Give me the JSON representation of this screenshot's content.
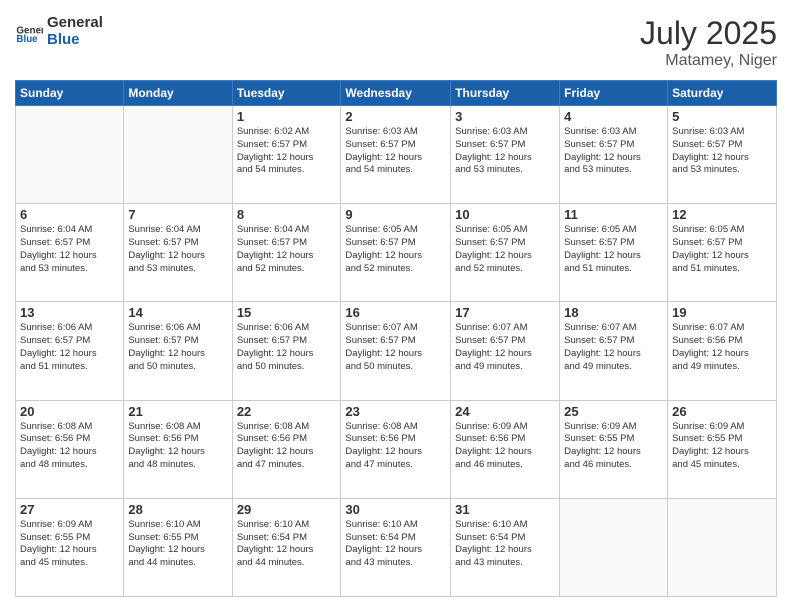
{
  "header": {
    "logo_general": "General",
    "logo_blue": "Blue",
    "month": "July 2025",
    "location": "Matamey, Niger"
  },
  "weekdays": [
    "Sunday",
    "Monday",
    "Tuesday",
    "Wednesday",
    "Thursday",
    "Friday",
    "Saturday"
  ],
  "weeks": [
    [
      {
        "day": "",
        "info": ""
      },
      {
        "day": "",
        "info": ""
      },
      {
        "day": "1",
        "info": "Sunrise: 6:02 AM\nSunset: 6:57 PM\nDaylight: 12 hours\nand 54 minutes."
      },
      {
        "day": "2",
        "info": "Sunrise: 6:03 AM\nSunset: 6:57 PM\nDaylight: 12 hours\nand 54 minutes."
      },
      {
        "day": "3",
        "info": "Sunrise: 6:03 AM\nSunset: 6:57 PM\nDaylight: 12 hours\nand 53 minutes."
      },
      {
        "day": "4",
        "info": "Sunrise: 6:03 AM\nSunset: 6:57 PM\nDaylight: 12 hours\nand 53 minutes."
      },
      {
        "day": "5",
        "info": "Sunrise: 6:03 AM\nSunset: 6:57 PM\nDaylight: 12 hours\nand 53 minutes."
      }
    ],
    [
      {
        "day": "6",
        "info": "Sunrise: 6:04 AM\nSunset: 6:57 PM\nDaylight: 12 hours\nand 53 minutes."
      },
      {
        "day": "7",
        "info": "Sunrise: 6:04 AM\nSunset: 6:57 PM\nDaylight: 12 hours\nand 53 minutes."
      },
      {
        "day": "8",
        "info": "Sunrise: 6:04 AM\nSunset: 6:57 PM\nDaylight: 12 hours\nand 52 minutes."
      },
      {
        "day": "9",
        "info": "Sunrise: 6:05 AM\nSunset: 6:57 PM\nDaylight: 12 hours\nand 52 minutes."
      },
      {
        "day": "10",
        "info": "Sunrise: 6:05 AM\nSunset: 6:57 PM\nDaylight: 12 hours\nand 52 minutes."
      },
      {
        "day": "11",
        "info": "Sunrise: 6:05 AM\nSunset: 6:57 PM\nDaylight: 12 hours\nand 51 minutes."
      },
      {
        "day": "12",
        "info": "Sunrise: 6:05 AM\nSunset: 6:57 PM\nDaylight: 12 hours\nand 51 minutes."
      }
    ],
    [
      {
        "day": "13",
        "info": "Sunrise: 6:06 AM\nSunset: 6:57 PM\nDaylight: 12 hours\nand 51 minutes."
      },
      {
        "day": "14",
        "info": "Sunrise: 6:06 AM\nSunset: 6:57 PM\nDaylight: 12 hours\nand 50 minutes."
      },
      {
        "day": "15",
        "info": "Sunrise: 6:06 AM\nSunset: 6:57 PM\nDaylight: 12 hours\nand 50 minutes."
      },
      {
        "day": "16",
        "info": "Sunrise: 6:07 AM\nSunset: 6:57 PM\nDaylight: 12 hours\nand 50 minutes."
      },
      {
        "day": "17",
        "info": "Sunrise: 6:07 AM\nSunset: 6:57 PM\nDaylight: 12 hours\nand 49 minutes."
      },
      {
        "day": "18",
        "info": "Sunrise: 6:07 AM\nSunset: 6:57 PM\nDaylight: 12 hours\nand 49 minutes."
      },
      {
        "day": "19",
        "info": "Sunrise: 6:07 AM\nSunset: 6:56 PM\nDaylight: 12 hours\nand 49 minutes."
      }
    ],
    [
      {
        "day": "20",
        "info": "Sunrise: 6:08 AM\nSunset: 6:56 PM\nDaylight: 12 hours\nand 48 minutes."
      },
      {
        "day": "21",
        "info": "Sunrise: 6:08 AM\nSunset: 6:56 PM\nDaylight: 12 hours\nand 48 minutes."
      },
      {
        "day": "22",
        "info": "Sunrise: 6:08 AM\nSunset: 6:56 PM\nDaylight: 12 hours\nand 47 minutes."
      },
      {
        "day": "23",
        "info": "Sunrise: 6:08 AM\nSunset: 6:56 PM\nDaylight: 12 hours\nand 47 minutes."
      },
      {
        "day": "24",
        "info": "Sunrise: 6:09 AM\nSunset: 6:56 PM\nDaylight: 12 hours\nand 46 minutes."
      },
      {
        "day": "25",
        "info": "Sunrise: 6:09 AM\nSunset: 6:55 PM\nDaylight: 12 hours\nand 46 minutes."
      },
      {
        "day": "26",
        "info": "Sunrise: 6:09 AM\nSunset: 6:55 PM\nDaylight: 12 hours\nand 45 minutes."
      }
    ],
    [
      {
        "day": "27",
        "info": "Sunrise: 6:09 AM\nSunset: 6:55 PM\nDaylight: 12 hours\nand 45 minutes."
      },
      {
        "day": "28",
        "info": "Sunrise: 6:10 AM\nSunset: 6:55 PM\nDaylight: 12 hours\nand 44 minutes."
      },
      {
        "day": "29",
        "info": "Sunrise: 6:10 AM\nSunset: 6:54 PM\nDaylight: 12 hours\nand 44 minutes."
      },
      {
        "day": "30",
        "info": "Sunrise: 6:10 AM\nSunset: 6:54 PM\nDaylight: 12 hours\nand 43 minutes."
      },
      {
        "day": "31",
        "info": "Sunrise: 6:10 AM\nSunset: 6:54 PM\nDaylight: 12 hours\nand 43 minutes."
      },
      {
        "day": "",
        "info": ""
      },
      {
        "day": "",
        "info": ""
      }
    ]
  ]
}
